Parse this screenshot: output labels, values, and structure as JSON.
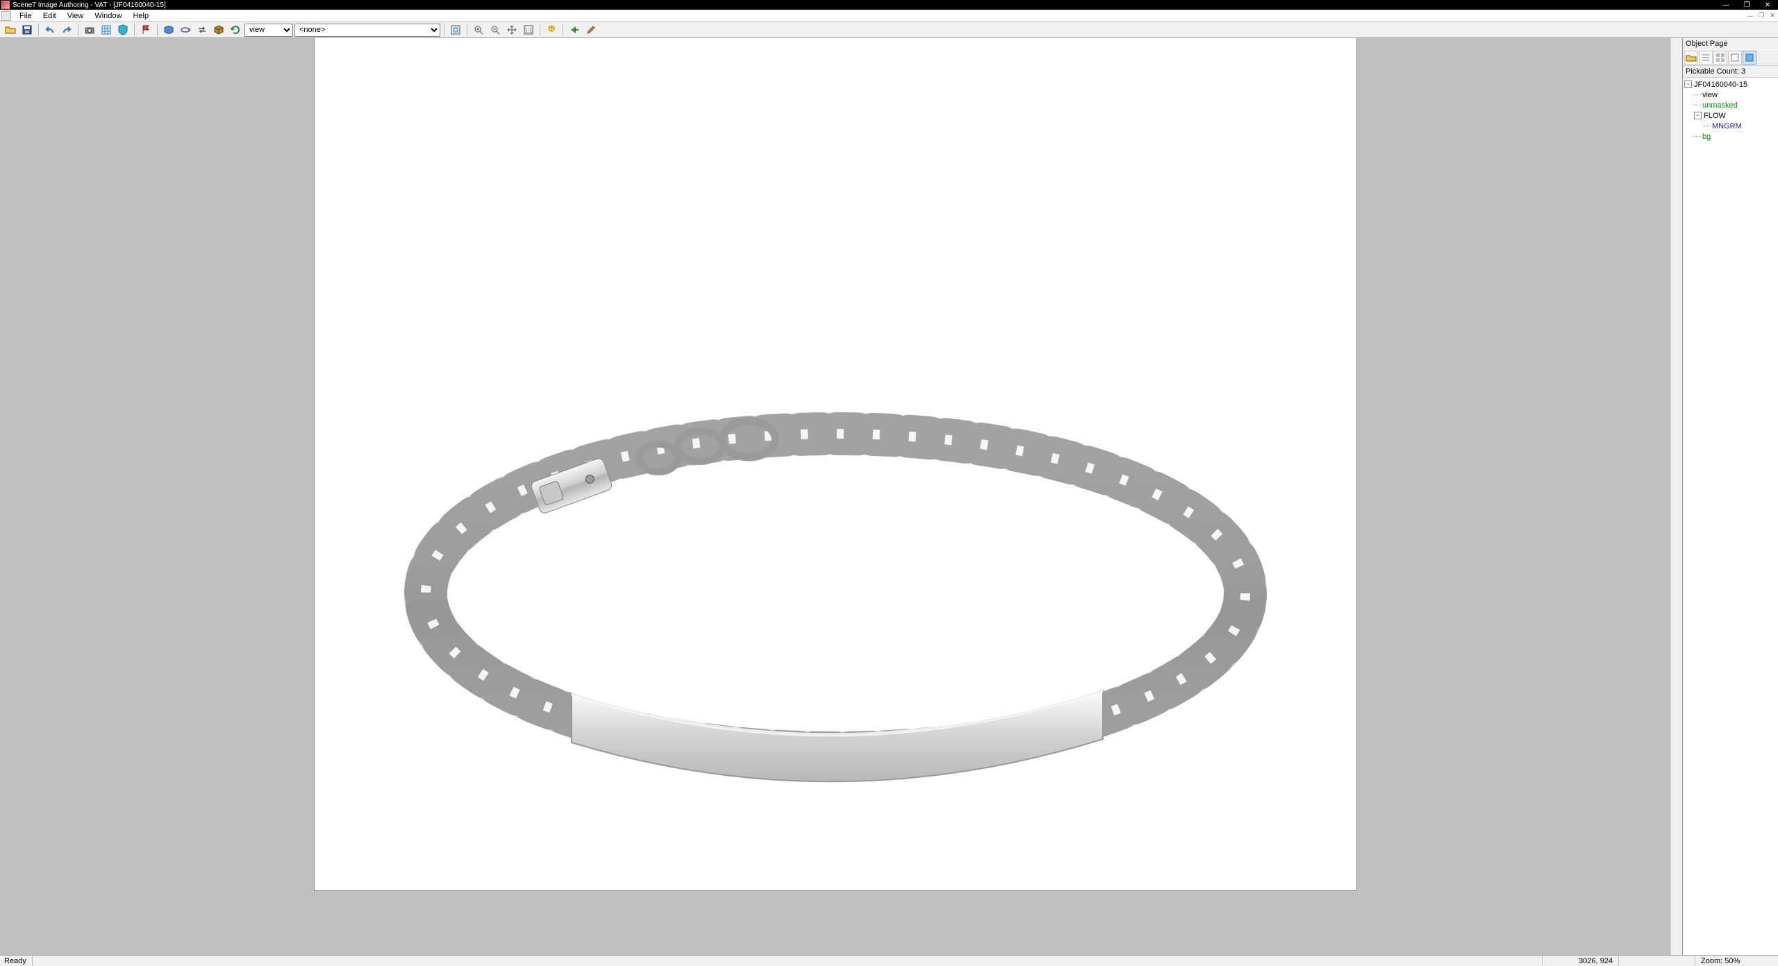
{
  "titlebar": {
    "title": "Scene7 Image Authoring - VAT - [JF04160040-15]",
    "minimize_glyph": "—",
    "maximize_glyph": "❐",
    "close_glyph": "✕"
  },
  "menubar": {
    "file": "File",
    "edit": "Edit",
    "view": "View",
    "window": "Window",
    "help": "Help",
    "mdi_minimize": "—",
    "mdi_restore": "❐",
    "mdi_close": "✕"
  },
  "toolbar": {
    "open_tip": "Open",
    "save_tip": "Save",
    "undo_tip": "Undo",
    "redo_tip": "Redo",
    "camera_tip": "Camera",
    "grid_tip": "Grid",
    "shield_tip": "Shield",
    "flag_tip": "Flag",
    "pano_tip": "Panorama",
    "spin_tip": "Spin",
    "swap_tip": "Swap",
    "cube_tip": "3D",
    "refresh_tip": "Refresh",
    "view_select": "view",
    "preset_select": "<none>",
    "fit_tip": "Fit",
    "zoomin_tip": "Zoom In",
    "zoomout_tip": "Zoom Out",
    "pan_tip": "Pan",
    "actual_tip": "Actual Pixels",
    "help_tip": "Help",
    "back_tip": "Back",
    "edit_tip": "Edit"
  },
  "panel": {
    "title": "Object Page",
    "count_label": "Pickable Count: 3",
    "tree": {
      "root": "JF04160040-15",
      "view": "view",
      "unmasked": "unmasked",
      "flow": "FLOW",
      "mngrm": "MNGRM",
      "bg": "bg"
    }
  },
  "status": {
    "ready": "Ready",
    "coords": "3026, 924",
    "zoom": "Zoom:  50%"
  }
}
